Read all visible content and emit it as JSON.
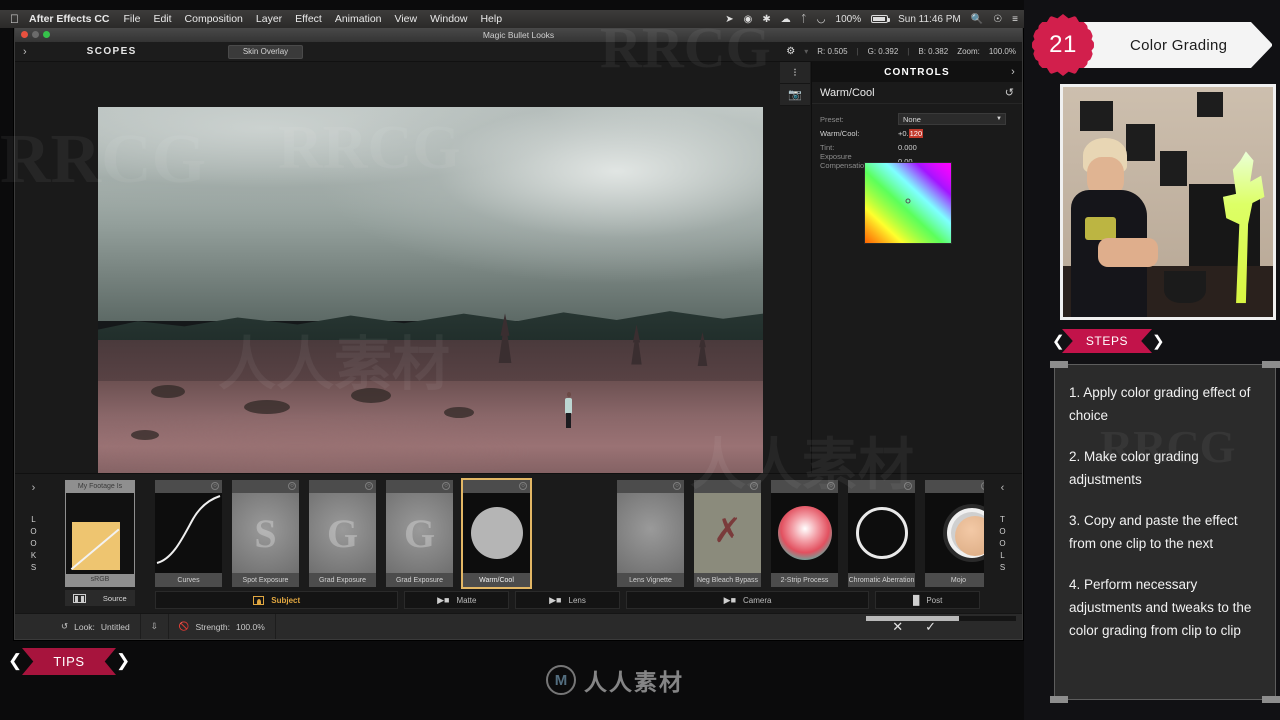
{
  "menubar": {
    "apple_icon": "apple-icon",
    "app_name": "After Effects CC",
    "items": [
      "File",
      "Edit",
      "Composition",
      "Layer",
      "Effect",
      "Animation",
      "View",
      "Window",
      "Help"
    ],
    "status": {
      "location_icon": "location-arrow-icon",
      "record_icon": "record-icon",
      "brightness_icon": "brightness-icon",
      "dropbox_icon": "dropbox-icon",
      "bluetooth_icon": "bluetooth-icon",
      "wifi_icon": "wifi-icon",
      "battery_percent": "100%",
      "clock": "Sun 11:46 PM",
      "search_icon": "search-icon",
      "user_icon": "user-icon",
      "list_icon": "list-icon"
    }
  },
  "window": {
    "title": "Magic Bullet Looks"
  },
  "scopes": {
    "expand_icon": "chevron-right-icon",
    "label": "SCOPES",
    "skin_overlay": "Skin Overlay",
    "gear_icon": "gear-icon",
    "readout_r": "R: 0.505",
    "readout_g": "G: 0.392",
    "readout_b": "B: 0.382",
    "zoom_label": "Zoom:",
    "zoom_value": "100.0%"
  },
  "controls": {
    "header": "CONTROLS",
    "collapse_icon": "chevron-right-icon",
    "effect_name": "Warm/Cool",
    "reset_icon": "reset-icon",
    "dots_icon": "dots-icon",
    "camera_icon": "camera-icon",
    "rows": [
      {
        "label": "Preset:",
        "value": "None",
        "type": "dropdown"
      },
      {
        "label": "Warm/Cool:",
        "value": "+0.120",
        "type": "number",
        "highlight": "120"
      },
      {
        "label": "Tint:",
        "value": "0.000",
        "type": "number"
      },
      {
        "label": "Exposure Compensation:",
        "value": "0.00",
        "type": "number"
      }
    ],
    "color_picker": "color-square-picker"
  },
  "looks": {
    "sidebar_left": "LOOKS",
    "sidebar_right": "TOOLS",
    "left_arrow_icon": "chevron-right-icon",
    "right_arrow_icon": "chevron-left-icon",
    "my_footage": {
      "caption": "My Footage Is",
      "colorspace": "sRGB",
      "source_label": "Source",
      "film_icon": "film-icon"
    },
    "cards": [
      {
        "label": "Curves",
        "thumb": "curve",
        "selected": false
      },
      {
        "label": "Spot Exposure",
        "thumb": "letter-S",
        "selected": false
      },
      {
        "label": "Grad Exposure",
        "thumb": "letter-G",
        "selected": false
      },
      {
        "label": "Grad Exposure",
        "thumb": "letter-G",
        "selected": false
      },
      {
        "label": "Warm/Cool",
        "thumb": "gray-circle",
        "selected": true
      },
      {
        "label": "",
        "thumb": "none",
        "selected": false
      },
      {
        "label": "Lens Vignette",
        "thumb": "vignette",
        "selected": false
      },
      {
        "label": "Neg Bleach Bypass",
        "thumb": "bleach",
        "selected": false
      },
      {
        "label": "2-Strip Process",
        "thumb": "two-strip",
        "selected": false
      },
      {
        "label": "Chromatic Aberration",
        "thumb": "ring",
        "selected": false
      },
      {
        "label": "Mojo",
        "thumb": "mojo",
        "selected": false
      }
    ],
    "tasks": [
      {
        "label": "Subject",
        "active": true,
        "icon": "subject-icon"
      },
      {
        "label": "Matte",
        "active": false,
        "icon": "pin-icon"
      },
      {
        "label": "Lens",
        "active": false,
        "icon": "pin-icon"
      },
      {
        "label": "Camera",
        "active": false,
        "icon": "pin-icon"
      },
      {
        "label": "Post",
        "active": false,
        "icon": "post-icon"
      }
    ]
  },
  "statusbar": {
    "reset_icon": "reset-icon",
    "look_label": "Look:",
    "look_value": "Untitled",
    "save_icon": "save-icon",
    "strength_icon": "no-entry-icon",
    "strength_label": "Strength:",
    "strength_value": "100.0%",
    "cancel_icon": "close-icon",
    "confirm_icon": "check-icon"
  },
  "tutorial": {
    "badge_number": "21",
    "title": "Color Grading",
    "steps_label": "STEPS",
    "tips_label": "TIPS",
    "steps": [
      "1. Apply color grading effect of choice",
      "2. Make color grading adjustments",
      "3. Copy and paste the effect from one clip to the next",
      "4. Perform necessary adjustments and tweaks to the color grading from clip to clip"
    ]
  },
  "watermarks": {
    "brand_latin": "RRCG",
    "brand_cn": "人人素材",
    "logo_mark": "M"
  },
  "colors": {
    "accent_crimson": "#d21f4c",
    "accent_gold": "#e0a640",
    "panel_dark": "#1a1a1a",
    "highlight_red": "#c0392b"
  }
}
